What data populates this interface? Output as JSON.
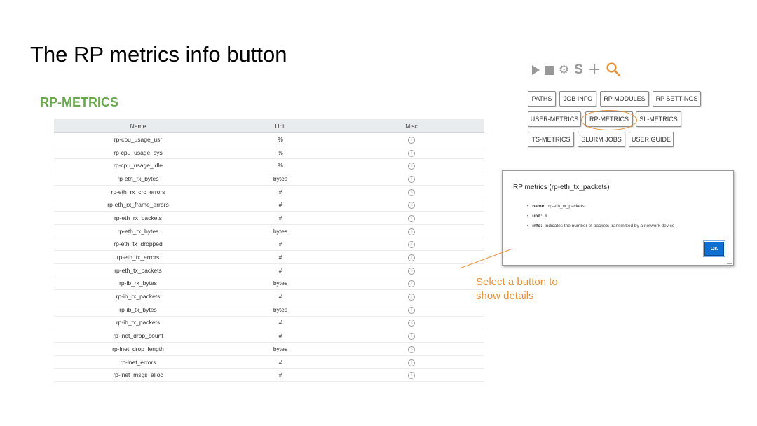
{
  "slide": {
    "title": "The RP metrics info button"
  },
  "section": {
    "title": "RP-METRICS"
  },
  "table": {
    "headers": [
      "Name",
      "Unit",
      "Misc"
    ],
    "rows": [
      {
        "name": "rp-cpu_usage_usr",
        "unit": "%"
      },
      {
        "name": "rp-cpu_usage_sys",
        "unit": "%"
      },
      {
        "name": "rp-cpu_usage_idle",
        "unit": "%"
      },
      {
        "name": "rp-eth_rx_bytes",
        "unit": "bytes"
      },
      {
        "name": "rp-eth_rx_crc_errors",
        "unit": "#"
      },
      {
        "name": "rp-eth_rx_frame_errors",
        "unit": "#"
      },
      {
        "name": "rp-eth_rx_packets",
        "unit": "#"
      },
      {
        "name": "rp-eth_tx_bytes",
        "unit": "bytes"
      },
      {
        "name": "rp-eth_tx_dropped",
        "unit": "#"
      },
      {
        "name": "rp-eth_tx_errors",
        "unit": "#"
      },
      {
        "name": "rp-eth_tx_packets",
        "unit": "#"
      },
      {
        "name": "rp-ib_rx_bytes",
        "unit": "bytes"
      },
      {
        "name": "rp-ib_rx_packets",
        "unit": "#"
      },
      {
        "name": "rp-ib_tx_bytes",
        "unit": "bytes"
      },
      {
        "name": "rp-ib_tx_packets",
        "unit": "#"
      },
      {
        "name": "rp-lnet_drop_count",
        "unit": "#"
      },
      {
        "name": "rp-lnet_drop_length",
        "unit": "bytes"
      },
      {
        "name": "rp-lnet_errors",
        "unit": "#"
      },
      {
        "name": "rp-lnet_msgs_alloc",
        "unit": "#"
      }
    ]
  },
  "toolbar": {
    "icons": [
      "play-icon",
      "stop-icon",
      "gear-icon",
      "s-icon",
      "plus-icon",
      "search-icon"
    ],
    "s_label": "S",
    "plus_label": "+",
    "search_color": "#e69138"
  },
  "nav_buttons": {
    "paths": "PATHS",
    "job_info": "JOB INFO",
    "rp_modules": "RP MODULES",
    "rp_settings": "RP SETTINGS",
    "user_metrics": "USER-METRICS",
    "rp_metrics": "RP-METRICS",
    "sl_metrics": "SL-METRICS",
    "ts_metrics": "TS-METRICS",
    "slurm_jobs": "SLURM JOBS",
    "user_guide": "USER GUIDE"
  },
  "dialog": {
    "title": "RP metrics (rp-eth_tx_packets)",
    "name_key": "name:",
    "name_val": "rp-eth_tx_packets",
    "unit_key": "unit:",
    "unit_val": "#",
    "info_key": "info:",
    "info_val": "Indicates the number of packets transmitted by a network device",
    "ok_label": "OK"
  },
  "callout": {
    "line1": "Select a button to",
    "line2": "show details"
  },
  "colors": {
    "accent": "#e69138",
    "section_title": "#6aa84f",
    "ok_button": "#0d6fd1"
  }
}
